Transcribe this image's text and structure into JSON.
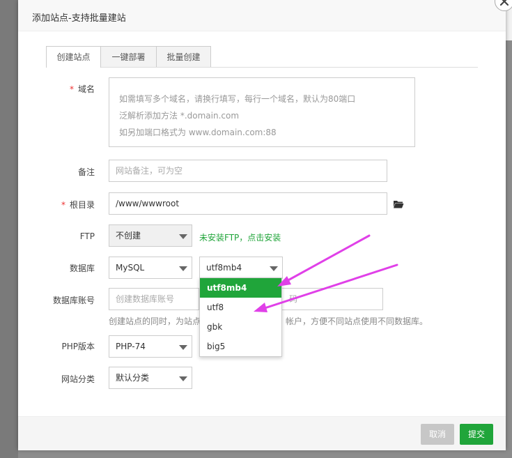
{
  "dialog": {
    "title": "添加站点-支持批量建站"
  },
  "tabs": [
    {
      "label": "创建站点",
      "active": true
    },
    {
      "label": "一键部署",
      "active": false
    },
    {
      "label": "批量创建",
      "active": false
    }
  ],
  "form": {
    "domain": {
      "label": "域名",
      "required": "*",
      "placeholder_lines": [
        "如需填写多个域名，请换行填写，每行一个域名，默认为80端口",
        "泛解析添加方法 *.domain.com",
        "如另加端口格式为 www.domain.com:88"
      ]
    },
    "remark": {
      "label": "备注",
      "placeholder": "网站备注，可为空"
    },
    "root": {
      "label": "根目录",
      "required": "*",
      "value": "/www/wwwroot"
    },
    "ftp": {
      "label": "FTP",
      "value": "不创建",
      "hint": "未安装FTP，点击安装"
    },
    "database": {
      "label": "数据库",
      "type": "MySQL",
      "charset": "utf8mb4",
      "charset_options": [
        "utf8mb4",
        "utf8",
        "gbk",
        "big5"
      ],
      "selected_option": "utf8mb4"
    },
    "db_account": {
      "label": "数据库账号",
      "user_placeholder": "创建数据库账号",
      "password_placeholder_visible": "码",
      "hint_left": "创建站点的同时，为站点",
      "hint_right": "帐户，方便不同站点使用不同数据库。"
    },
    "php": {
      "label": "PHP版本",
      "value": "PHP-74"
    },
    "category": {
      "label": "网站分类",
      "value": "默认分类"
    }
  },
  "footer": {
    "cancel_label": "取消",
    "submit_label": "提交"
  },
  "colors": {
    "accent": "#20a53a",
    "required": "#ee3333",
    "annotation_arrow": "#e040e8"
  }
}
